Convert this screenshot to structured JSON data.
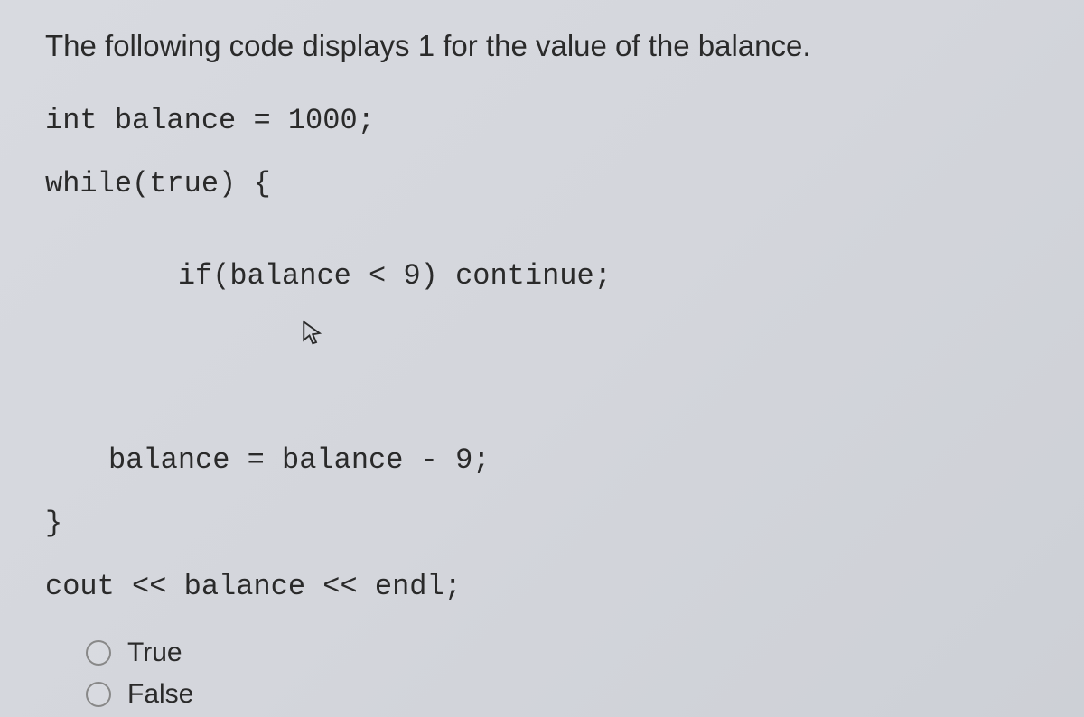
{
  "question": "The following code displays 1 for the value of the balance.",
  "code": {
    "line1": "int balance = 1000;",
    "line2": "while(true) {",
    "line3": "if(balance < 9) continue;",
    "line4": "balance = balance - 9;",
    "line5": "}",
    "line6": "cout << balance << endl;"
  },
  "options": {
    "true_label": "True",
    "false_label": "False"
  }
}
